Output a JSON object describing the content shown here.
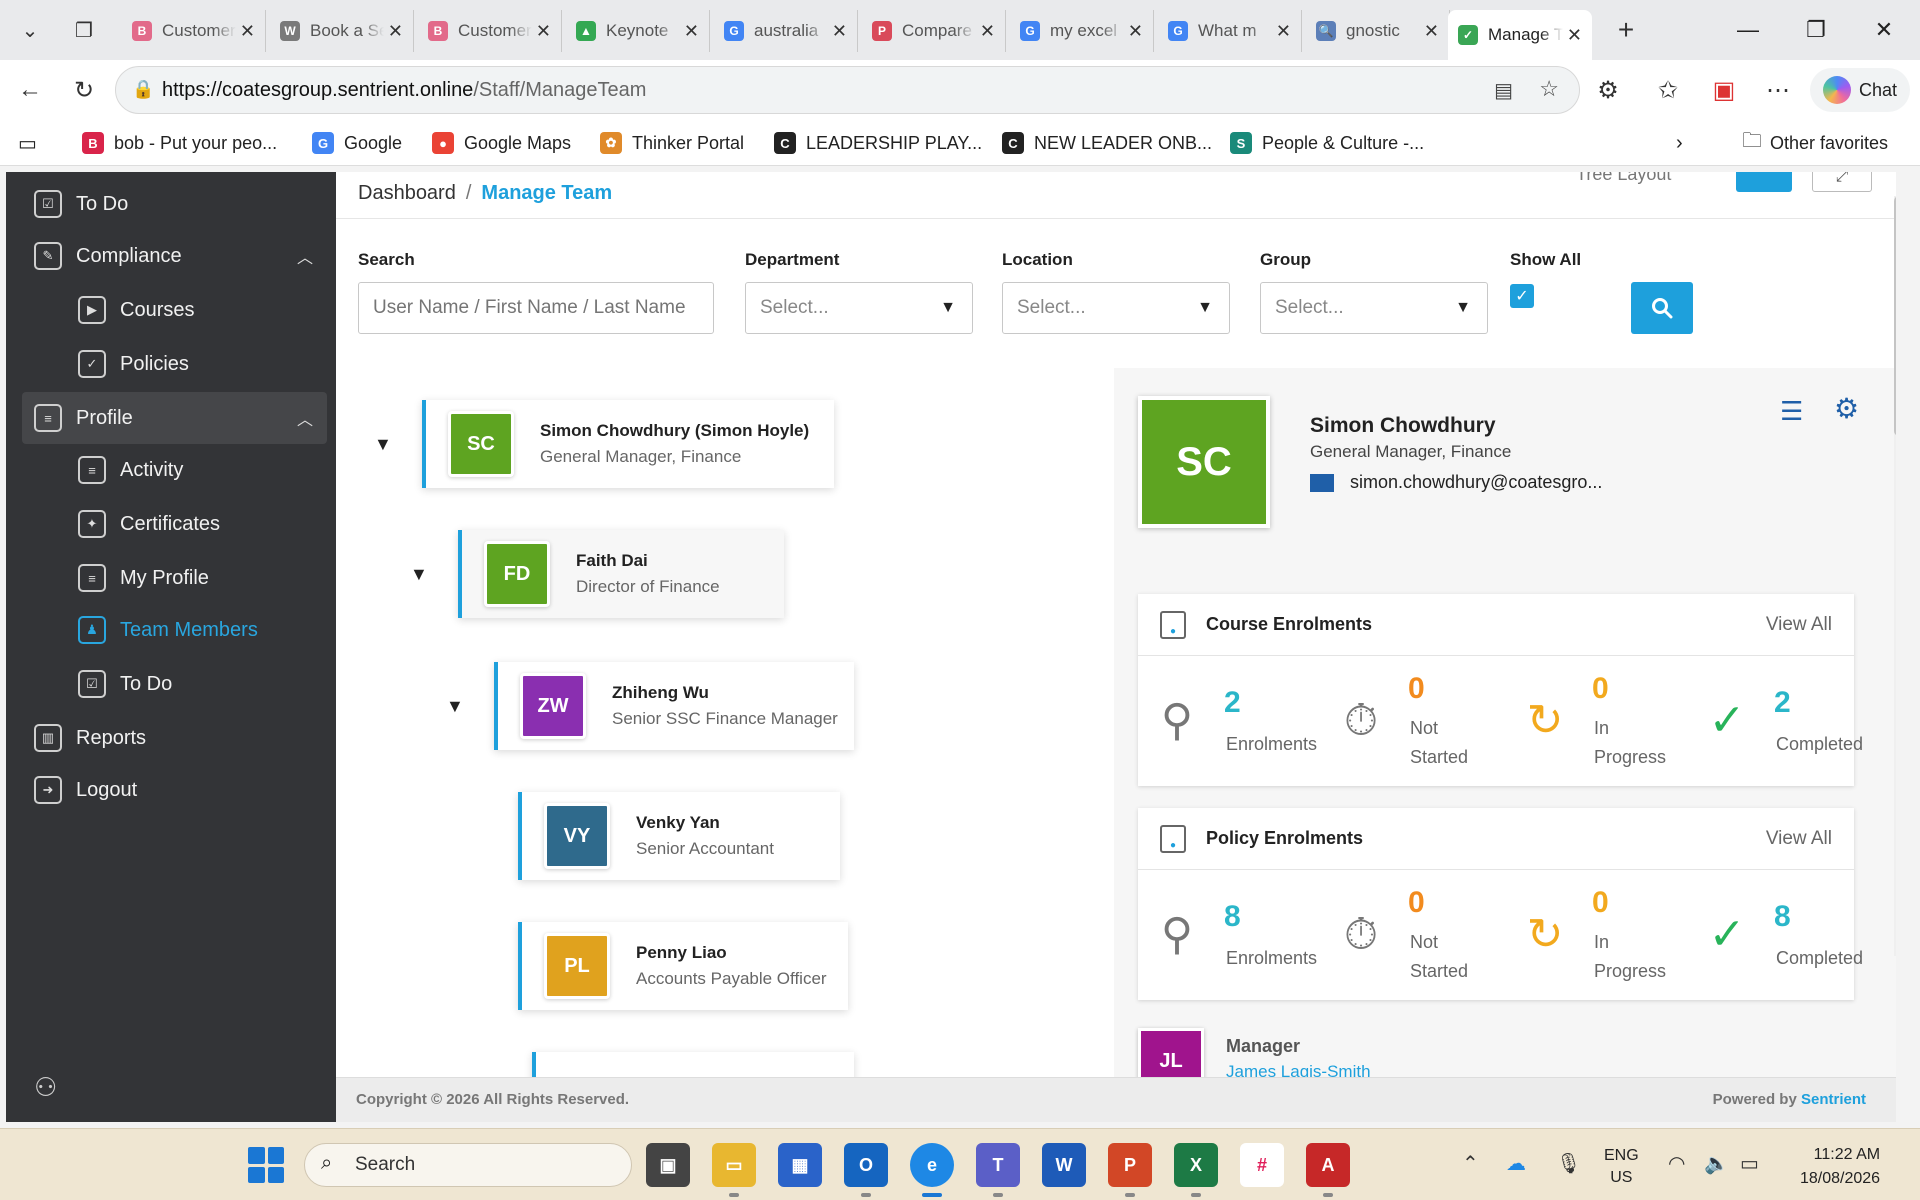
{
  "browser": {
    "tabs": [
      {
        "label": "Customer",
        "favicon": "B",
        "color": "#e26a8a"
      },
      {
        "label": "Book a Service",
        "favicon": "W",
        "color": "#7a7a7a"
      },
      {
        "label": "Customer",
        "favicon": "B",
        "color": "#e26a8a"
      },
      {
        "label": "Keynote",
        "favicon": "▲",
        "color": "#34a853"
      },
      {
        "label": "australia",
        "favicon": "G",
        "color": "#4285f4"
      },
      {
        "label": "Compare",
        "favicon": "P",
        "color": "#d94a5a"
      },
      {
        "label": "my excel",
        "favicon": "G",
        "color": "#4285f4"
      },
      {
        "label": "What m",
        "favicon": "G",
        "color": "#4285f4"
      },
      {
        "label": "gnostic",
        "favicon": "🔍",
        "color": "#5c7fb8"
      },
      {
        "label": "Manage Team",
        "favicon": "✓",
        "color": "#3aa655"
      }
    ],
    "new_tab": "+",
    "url_host": "https://coatesgroup.sentrient.online",
    "url_path": "/Staff/ManageTeam",
    "chat_label": "Chat",
    "favorites": [
      {
        "label": "bob - Put your peo...",
        "icon": "B",
        "color": "#d9244a"
      },
      {
        "label": "Google",
        "icon": "G",
        "color": "#4285f4"
      },
      {
        "label": "Google Maps",
        "icon": "●",
        "color": "#ea4335"
      },
      {
        "label": "Thinker Portal",
        "icon": "✿",
        "color": "#e08a2a"
      },
      {
        "label": "LEADERSHIP PLAY...",
        "icon": "C",
        "color": "#222222"
      },
      {
        "label": "NEW LEADER ONB...",
        "icon": "C",
        "color": "#222222"
      },
      {
        "label": "People & Culture -...",
        "icon": "S",
        "color": "#1a8a7a"
      }
    ],
    "other_favorites": "Other favorites"
  },
  "sidebar": {
    "items": [
      {
        "label": "To Do",
        "icon": "checklist-icon",
        "glyph": "☑"
      },
      {
        "label": "Compliance",
        "icon": "compliance-icon",
        "glyph": "✎"
      },
      {
        "label": "Courses",
        "icon": "courses-icon",
        "glyph": "▶"
      },
      {
        "label": "Policies",
        "icon": "shield-icon",
        "glyph": "✓"
      },
      {
        "label": "Profile",
        "icon": "profile-icon",
        "glyph": "≡"
      },
      {
        "label": "Activity",
        "icon": "activity-icon",
        "glyph": "≡"
      },
      {
        "label": "Certificates",
        "icon": "certificate-icon",
        "glyph": "✦"
      },
      {
        "label": "My Profile",
        "icon": "my-profile-icon",
        "glyph": "≡"
      },
      {
        "label": "Team Members",
        "icon": "team-icon",
        "glyph": "♟"
      },
      {
        "label": "To Do",
        "icon": "checklist-icon",
        "glyph": "☑"
      },
      {
        "label": "Reports",
        "icon": "reports-icon",
        "glyph": "▥"
      },
      {
        "label": "Logout",
        "icon": "logout-icon",
        "glyph": "➜"
      }
    ]
  },
  "main": {
    "breadcrumb": {
      "root": "Dashboard",
      "separator": "/",
      "current": "Manage Team"
    },
    "tree_layout_label": "Tree Layout",
    "filters": {
      "search_label": "Search",
      "search_placeholder": "User Name / First Name / Last Name",
      "department_label": "Department",
      "department_value": "Select...",
      "location_label": "Location",
      "location_value": "Select...",
      "group_label": "Group",
      "group_value": "Select...",
      "show_all_label": "Show All",
      "show_all_checked": true
    },
    "tree": [
      {
        "initials": "SC",
        "name": "Simon Chowdhury (Simon Hoyle)",
        "title": "General Manager, Finance",
        "color": "#5ea421"
      },
      {
        "initials": "FD",
        "name": "Faith Dai",
        "title": "Director of Finance",
        "color": "#5ea421"
      },
      {
        "initials": "ZW",
        "name": "Zhiheng Wu",
        "title": "Senior SSC Finance Manager",
        "color": "#8a2fb0"
      },
      {
        "initials": "VY",
        "name": "Venky Yan",
        "title": "Senior Accountant",
        "color": "#2f6a8c"
      },
      {
        "initials": "PL",
        "name": "Penny Liao",
        "title": "Accounts Payable Officer",
        "color": "#e0a21e"
      }
    ],
    "detail": {
      "initials": "SC",
      "name": "Simon Chowdhury",
      "title": "General Manager, Finance",
      "email": "simon.chowdhury@coatesgro...",
      "course": {
        "title": "Course Enrolments",
        "view_all": "View All",
        "enrolments": "2",
        "enrolments_label": "Enrolments",
        "not_started": "0",
        "not_started_label_1": "Not",
        "not_started_label_2": "Started",
        "in_progress": "0",
        "in_progress_label_1": "In",
        "in_progress_label_2": "Progress",
        "completed": "2",
        "completed_label": "Completed"
      },
      "policy": {
        "title": "Policy Enrolments",
        "view_all": "View All",
        "enrolments": "8",
        "enrolments_label": "Enrolments",
        "not_started": "0",
        "not_started_label_1": "Not",
        "not_started_label_2": "Started",
        "in_progress": "0",
        "in_progress_label_1": "In",
        "in_progress_label_2": "Progress",
        "completed": "8",
        "completed_label": "Completed"
      },
      "manager_label": "Manager",
      "manager_initials": "JL",
      "manager_name": "James Lagis-Smith"
    },
    "footer": {
      "copyright": "Copyright © 2026 All Rights Reserved.",
      "powered_prefix": "Powered by",
      "powered_brand": "Sentrient"
    }
  },
  "taskbar": {
    "search_label": "Search",
    "lang_1": "ENG",
    "lang_2": "US",
    "time": "11:22 AM",
    "date": "18/08/2026"
  }
}
